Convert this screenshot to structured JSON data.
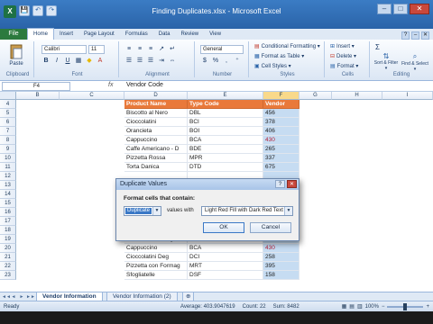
{
  "window": {
    "title": "Finding Duplicates.xlsx - Microsoft Excel",
    "logo_letter": "X",
    "controls": [
      "–",
      "□",
      "✕"
    ]
  },
  "quick_access": [
    "💾",
    "↶",
    "↷"
  ],
  "tabs": [
    "File",
    "Home",
    "Insert",
    "Page Layout",
    "Formulas",
    "Data",
    "Review",
    "View"
  ],
  "ribbon": {
    "clipboard": {
      "paste": "Paste",
      "label": "Clipboard"
    },
    "font": {
      "name": "Calibri",
      "size": "11",
      "bold": "B",
      "italic": "I",
      "underline": "U",
      "label": "Font"
    },
    "alignment": {
      "label": "Alignment"
    },
    "number": {
      "format": "General",
      "currency": "$",
      "percent": "%",
      "label": "Number"
    },
    "styles": {
      "conditional": "Conditional Formatting ▾",
      "table": "Format as Table ▾",
      "cell_styles": "Cell Styles ▾",
      "label": "Styles"
    },
    "cells": {
      "insert": "Insert ▾",
      "delete": "Delete ▾",
      "format": "Format ▾",
      "label": "Cells"
    },
    "editing": {
      "sum": "Σ",
      "sort": "Sort & Filter ▾",
      "find": "Find & Select ▾",
      "label": "Editing"
    }
  },
  "formula_bar": {
    "name_box": "F4",
    "fx": "fx",
    "content": "Vendor Code"
  },
  "columns": [
    "B",
    "C",
    "D",
    "E",
    "F",
    "G",
    "H",
    "I"
  ],
  "rows": [
    4,
    5,
    6,
    7,
    8,
    9,
    10,
    11,
    12,
    13,
    14,
    15,
    16,
    17,
    18,
    19,
    20,
    21,
    22,
    23
  ],
  "table": {
    "headers": [
      "Product Name",
      "Type Code",
      "Vendor"
    ],
    "top_rows": [
      {
        "row": 5,
        "name": "Biscotto al Nero",
        "code": "DBL",
        "vendor": "456",
        "dup": false
      },
      {
        "row": 6,
        "name": "Cioccolatini",
        "code": "BCI",
        "vendor": "378",
        "dup": false
      },
      {
        "row": 7,
        "name": "Orancieta",
        "code": "BOI",
        "vendor": "406",
        "dup": false
      },
      {
        "row": 8,
        "name": "Cappuccino",
        "code": "BCA",
        "vendor": "430",
        "dup": true
      },
      {
        "row": 9,
        "name": "Caffe Americano - D",
        "code": "BDE",
        "vendor": "265",
        "dup": false
      },
      {
        "row": 10,
        "name": "Pizzetta Rossa",
        "code": "MPR",
        "vendor": "337",
        "dup": false
      },
      {
        "row": 11,
        "name": "Torta Danica",
        "code": "DTD",
        "vendor": "675",
        "dup": false
      },
      {
        "row": 12,
        "name": "",
        "code": "",
        "vendor": "",
        "dup": false
      }
    ],
    "bottom_rows": [
      {
        "row": 19,
        "name": "Pizzetta con Funghi",
        "code": "MPC",
        "vendor": "657",
        "dup": false
      },
      {
        "row": 20,
        "name": "Cappuccino",
        "code": "BCA",
        "vendor": "430",
        "dup": true
      },
      {
        "row": 21,
        "name": "Cioccolatini Deg",
        "code": "DCI",
        "vendor": "258",
        "dup": false
      },
      {
        "row": 22,
        "name": "Pizzetta con Formag",
        "code": "MRT",
        "vendor": "395",
        "dup": false
      },
      {
        "row": 23,
        "name": "Sfogliatelle",
        "code": "DSF",
        "vendor": "158",
        "dup": false
      }
    ]
  },
  "sheets": {
    "nav": [
      "◄◄",
      "◄",
      "►",
      "►►"
    ],
    "tabs": [
      "Vendor Information",
      "Vendor Information (2)"
    ]
  },
  "status": {
    "ready": "Ready",
    "average": "Average: 403.9047619",
    "count": "Count: 22",
    "sum": "Sum: 8482",
    "zoom": "100%"
  },
  "dialog": {
    "title": "Duplicate Values",
    "controls": [
      "?",
      "✕"
    ],
    "label": "Format cells that contain:",
    "selected_type": "Duplicate",
    "middle_text": "values with",
    "format_option": "Light Red Fill with Dark Red Text",
    "ok": "OK",
    "cancel": "Cancel"
  },
  "colors": {
    "header_fill": "#e9793a",
    "duplicate_text": "#b4233c",
    "selected_column": "#c6dcf2",
    "title_bar": "#2a63a8",
    "file_tab": "#2c7a3e"
  }
}
